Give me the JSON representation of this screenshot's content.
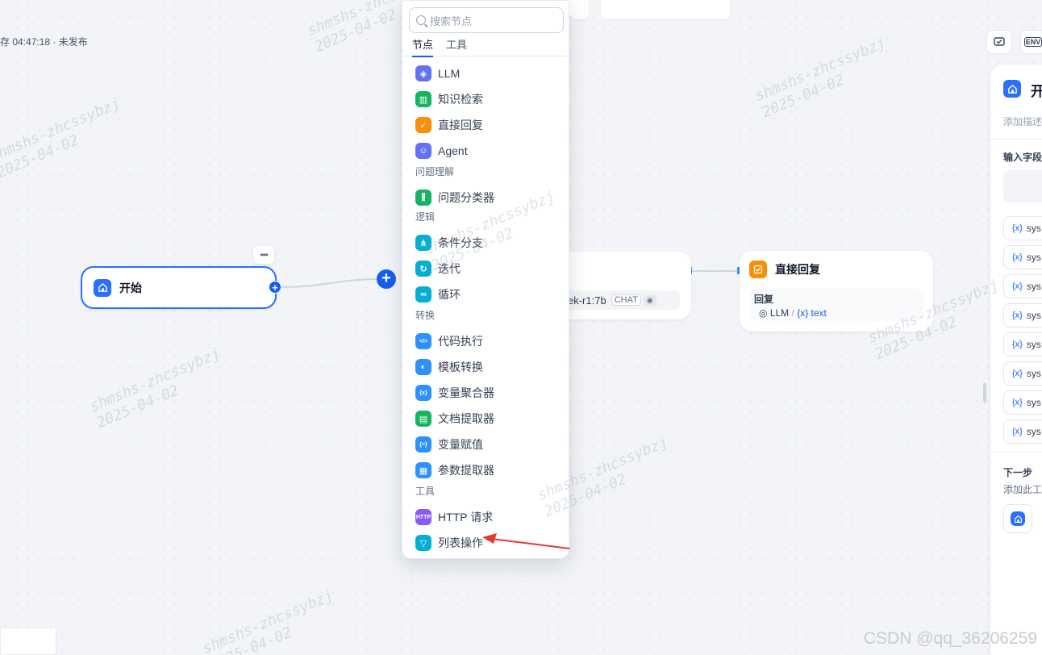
{
  "header": {
    "save_status": "存 04:47:18 · 未发布",
    "env_label": "ENV"
  },
  "canvas": {
    "start_node": {
      "title": "开始",
      "more": "•••"
    },
    "llm_node": {
      "model": "ek-r1:7b",
      "mode_tag": "CHAT",
      "eye": "◉"
    },
    "reply_node": {
      "title": "直接回复",
      "section": "回复",
      "source": "LLM",
      "separator": "/",
      "var": "{x} text"
    }
  },
  "picker": {
    "search_placeholder": "搜索节点",
    "tabs": [
      "节点",
      "工具"
    ],
    "items": [
      {
        "label": "LLM",
        "color": "#6172f3",
        "icon": "llm-icon",
        "glyph": "◈"
      },
      {
        "label": "知识检索",
        "color": "#16b364",
        "icon": "book-icon",
        "glyph": "▥"
      },
      {
        "label": "直接回复",
        "color": "#f79009",
        "icon": "reply-icon",
        "glyph": "✓"
      },
      {
        "label": "Agent",
        "color": "#6172f3",
        "icon": "agent-icon",
        "glyph": "☺"
      }
    ],
    "group_understanding": "问题理解",
    "classifier": {
      "label": "问题分类器",
      "color": "#16b364",
      "icon": "classifier-icon",
      "glyph": "⫼"
    },
    "group_logic": "逻辑",
    "logic_items": [
      {
        "label": "条件分支",
        "color": "#06aed4",
        "icon": "branch-icon",
        "glyph": "⋔"
      },
      {
        "label": "迭代",
        "color": "#06aed4",
        "icon": "iteration-icon",
        "glyph": "↻"
      },
      {
        "label": "循环",
        "color": "#06aed4",
        "icon": "loop-icon",
        "glyph": "∞"
      }
    ],
    "group_transform": "转换",
    "transform_items": [
      {
        "label": "代码执行",
        "color": "#2e90fa",
        "icon": "code-icon",
        "glyph": "</>"
      },
      {
        "label": "模板转换",
        "color": "#2e90fa",
        "icon": "template-icon",
        "glyph": "◐"
      },
      {
        "label": "变量聚合器",
        "color": "#2e90fa",
        "icon": "variable-aggregator-icon",
        "glyph": "{x}"
      },
      {
        "label": "文档提取器",
        "color": "#16b364",
        "icon": "document-icon",
        "glyph": "▤"
      },
      {
        "label": "变量赋值",
        "color": "#2e90fa",
        "icon": "assign-icon",
        "glyph": "{=}"
      },
      {
        "label": "参数提取器",
        "color": "#2e90fa",
        "icon": "parameter-icon",
        "glyph": "▦"
      }
    ],
    "group_tools": "工具",
    "tool_items": [
      {
        "label": "HTTP 请求",
        "color": "#875bf7",
        "icon": "http-icon",
        "glyph": "HTTP"
      },
      {
        "label": "列表操作",
        "color": "#06aed4",
        "icon": "list-filter-icon",
        "glyph": "▽"
      }
    ]
  },
  "right_panel": {
    "title": "开",
    "desc": "添加描述",
    "input_fields": "输入字段",
    "sys_label": "sys",
    "sys_var_icon": "{x}",
    "next_step": "下一步",
    "next_desc": "添加此工"
  },
  "watermark": {
    "line1": "shmshs-zhcssybzj",
    "line2": "2025-04-02"
  },
  "footer": {
    "csdn": "CSDN @qq_36206259"
  }
}
